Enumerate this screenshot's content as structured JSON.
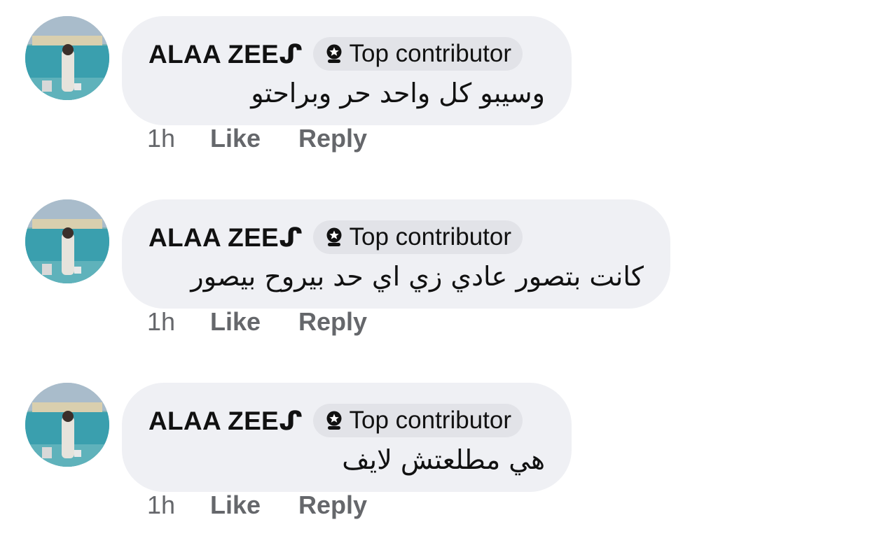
{
  "comments": [
    {
      "author": "ALAA ZEEᔑ",
      "badge": "Top contributor",
      "badge_icon": "top-contributor-badge-icon",
      "text": "وسيبو كل واحد حر وبراحتو",
      "time": "1h",
      "like_label": "Like",
      "reply_label": "Reply"
    },
    {
      "author": "ALAA ZEEᔑ",
      "badge": "Top contributor",
      "badge_icon": "top-contributor-badge-icon",
      "text": "كانت بتصور عادي زي اي حد بيروح بيصور",
      "time": "1h",
      "like_label": "Like",
      "reply_label": "Reply"
    },
    {
      "author": "ALAA ZEEᔑ",
      "badge": "Top contributor",
      "badge_icon": "top-contributor-badge-icon",
      "text": "هي مطلعتش لايف",
      "time": "1h",
      "like_label": "Like",
      "reply_label": "Reply"
    }
  ],
  "colors": {
    "bubble_bg": "#eff0f4",
    "badge_bg": "#e2e3e8",
    "meta_text": "#65676b",
    "primary_text": "#111111"
  }
}
